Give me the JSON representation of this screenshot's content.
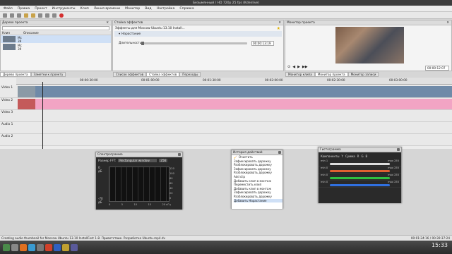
{
  "window": {
    "title": "Безымянный / HD 720p 25 fps (Kdenlive)"
  },
  "menu": [
    "Файл",
    "Правка",
    "Проект",
    "Инструменты",
    "Клип",
    "Линия времени",
    "Монитор",
    "Вид",
    "Настройка",
    "Справка"
  ],
  "project_tree": {
    "title": "Дерево проекта",
    "col_clip": "Клип",
    "col_desc": "Описание",
    "clips": [
      {
        "name": "Мс",
        "sub": "39"
      },
      {
        "name": "Мс",
        "sub": "39"
      }
    ]
  },
  "effects": {
    "title": "Стойка эффектов",
    "header": "Эффекты для Moscow Ubuntu 13.10 Install...",
    "effect_name": "Нарастание",
    "duration_label": "Длительность",
    "duration_value": "00:00:13:19"
  },
  "project_monitor": {
    "title": "Монитор проекта",
    "timecode": "00:00:12:07"
  },
  "mid_tabs": {
    "left": [
      "Дерево проекта",
      "Заметки к проекту"
    ],
    "center": [
      "Список эффектов",
      "Стойка эффектов",
      "Переходы"
    ],
    "right": [
      "Монитор клипа",
      "Монитор проекта",
      "Монитор записи"
    ]
  },
  "ruler": [
    "00:00:30:00",
    "00:01:00:00",
    "00:01:30:00",
    "00:02:00:00",
    "00:02:30:00",
    "00:03:00:00"
  ],
  "tracks": [
    {
      "name": "Video 1"
    },
    {
      "name": "Video 2"
    },
    {
      "name": "Video 3"
    },
    {
      "name": "Audio 1"
    },
    {
      "name": "Audio 2"
    }
  ],
  "spectrogram": {
    "title": "Спектрограмма",
    "fft_label": "Размер FFT:",
    "window": "Rectangular window",
    "fft_value": "256",
    "db_top": "0",
    "db_unit": "дБ",
    "db_bottom": "-70",
    "db_bottom_unit": "дБ",
    "x_ticks": [
      "0",
      "5",
      "10",
      "15",
      "20 кГц"
    ],
    "y_ticks": [
      "120",
      "100",
      "80",
      "60",
      "40",
      "20",
      "0"
    ]
  },
  "history": {
    "title": "История действий",
    "items": [
      "Очистить",
      "Зафиксировать дорожку",
      "Разблокировать дорожку",
      "Зафиксировать дорожку",
      "Разблокировать дорожку",
      "Add clip",
      "Добавить клип в монтаж",
      "Переместить клип",
      "Добавить клип в монтаж",
      "Зафиксировать дорожку",
      "Разблокировать дорожку",
      "Добавить Нарастание"
    ]
  },
  "histogram": {
    "title": "Гистограмма",
    "components_label": "Компоненты",
    "sum_label": "Сумма",
    "y": "Y",
    "r": "R",
    "g": "G",
    "b": "B",
    "min_label": "min",
    "max_label": "max",
    "rows": [
      {
        "min": "1",
        "max": "255",
        "color": "#dddddd"
      },
      {
        "min": "0",
        "max": "255",
        "color": "#e06030"
      },
      {
        "min": "0",
        "max": "255",
        "color": "#30c040"
      },
      {
        "min": "0",
        "max": "255",
        "color": "#3070e0"
      }
    ]
  },
  "status": {
    "message": "Creating audio thumbnail for Moscow Ubuntu 13.10 InstallFest 1-8. Приветствие. Разработка Ubuntu.mp4.dv",
    "timecode": "00:01:24:16 / 00:39:37:24"
  },
  "taskbar": {
    "clock": "15:33"
  }
}
